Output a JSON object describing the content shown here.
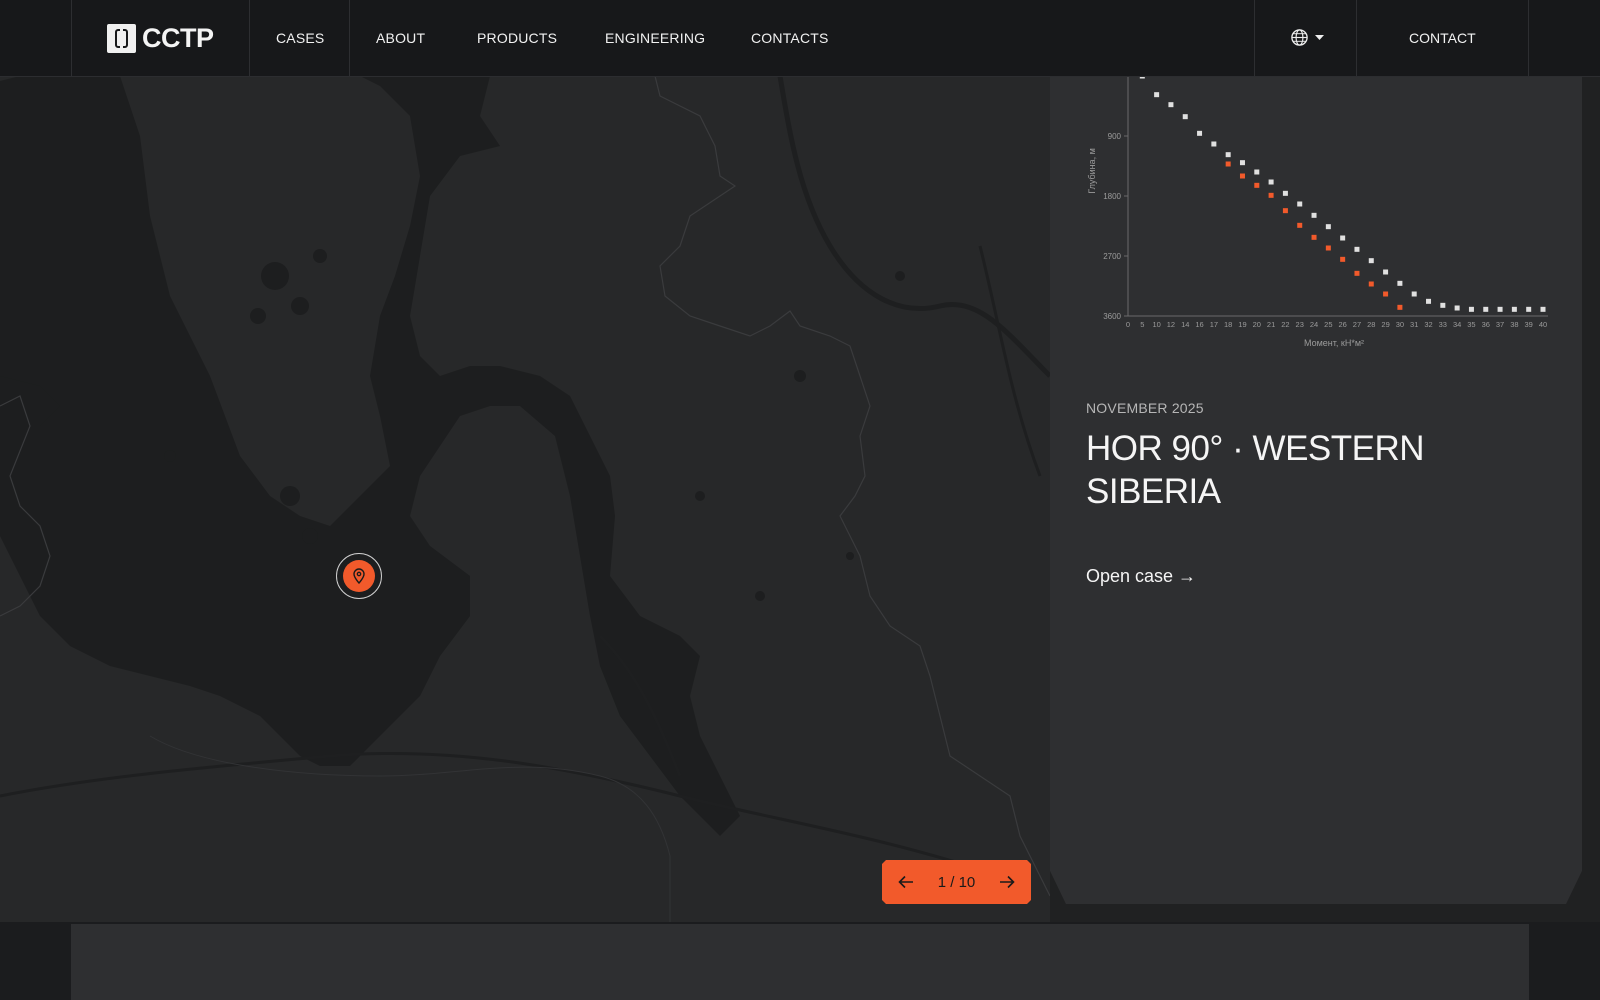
{
  "header": {
    "logo_text": "CCTP",
    "nav": [
      "CASES",
      "ABOUT",
      "PRODUCTS",
      "ENGINEERING",
      "CONTACTS"
    ],
    "language_icon": "globe-icon",
    "contact_label": "CONTACT"
  },
  "map": {
    "marker_icon": "location-pin-icon",
    "marker_color": "#f25a2b"
  },
  "chart_data": {
    "type": "scatter",
    "ylabel": "Глубина, м",
    "xlabel": "Момент, кН*м²",
    "y_ticks": [
      "900",
      "1800",
      "2700",
      "3600"
    ],
    "x_ticks": [
      "0",
      "5",
      "10",
      "12",
      "14",
      "16",
      "17",
      "18",
      "19",
      "20",
      "21",
      "22",
      "23",
      "24",
      "25",
      "26",
      "27",
      "28",
      "29",
      "30",
      "31",
      "32",
      "33",
      "34",
      "35",
      "36",
      "37",
      "38",
      "39",
      "40"
    ],
    "ylim": [
      0,
      3600
    ],
    "y_inverted": true,
    "series": [
      {
        "color": "#e0e0e0",
        "points": [
          [
            5,
            0
          ],
          [
            10,
            280
          ],
          [
            12,
            430
          ],
          [
            14,
            610
          ],
          [
            16,
            860
          ],
          [
            17,
            1020
          ],
          [
            18,
            1180
          ],
          [
            19,
            1300
          ],
          [
            20,
            1440
          ],
          [
            21,
            1590
          ],
          [
            22,
            1760
          ],
          [
            23,
            1920
          ],
          [
            24,
            2090
          ],
          [
            25,
            2260
          ],
          [
            26,
            2430
          ],
          [
            27,
            2600
          ],
          [
            28,
            2770
          ],
          [
            29,
            2940
          ],
          [
            30,
            3110
          ],
          [
            31,
            3270
          ],
          [
            32,
            3380
          ],
          [
            33,
            3440
          ],
          [
            34,
            3480
          ],
          [
            35,
            3500
          ],
          [
            36,
            3500
          ],
          [
            37,
            3500
          ],
          [
            38,
            3500
          ],
          [
            39,
            3500
          ],
          [
            40,
            3500
          ]
        ]
      },
      {
        "color": "#f25a2b",
        "points": [
          [
            18,
            1320
          ],
          [
            19,
            1500
          ],
          [
            20,
            1640
          ],
          [
            21,
            1790
          ],
          [
            22,
            2020
          ],
          [
            23,
            2240
          ],
          [
            24,
            2420
          ],
          [
            25,
            2580
          ],
          [
            26,
            2750
          ],
          [
            27,
            2960
          ],
          [
            28,
            3120
          ],
          [
            29,
            3270
          ],
          [
            30,
            3470
          ]
        ]
      }
    ]
  },
  "case": {
    "date": "NOVEMBER 2025",
    "title": "HOR 90° · WESTERN SIBERIA",
    "link_label": "Open case →"
  },
  "pager": {
    "label": "1 / 10",
    "prev_icon": "arrow-left-icon",
    "next_icon": "arrow-right-icon"
  }
}
